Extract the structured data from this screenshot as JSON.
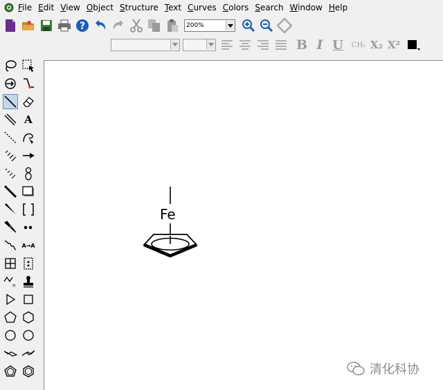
{
  "menubar": {
    "items": [
      "File",
      "Edit",
      "View",
      "Object",
      "Structure",
      "Text",
      "Curves",
      "Colors",
      "Search",
      "Window",
      "Help"
    ]
  },
  "toolbar": {
    "zoom_value": "200%"
  },
  "format_toolbar": {
    "bold": "B",
    "italic": "I",
    "underline": "U",
    "formula": "CH₂",
    "subscript": "X₂",
    "superscript": "X²"
  },
  "palette": {
    "text_tool_label": "A",
    "replace_tool_label": "A→A"
  },
  "canvas": {
    "atom_label": "Fe"
  },
  "watermark": {
    "text": "清化科协"
  },
  "colors": {
    "accent": "#1a5fb4",
    "document_icon": "#6a2c8f",
    "selection": "#c4d6ea"
  }
}
